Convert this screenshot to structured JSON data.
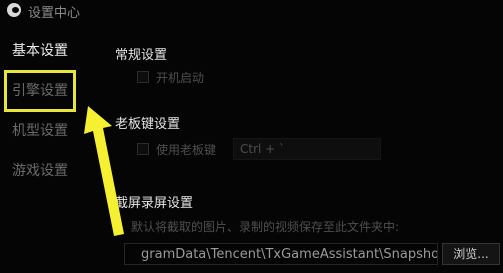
{
  "window": {
    "title": "设置中心"
  },
  "sidebar": {
    "items": [
      {
        "label": "基本设置"
      },
      {
        "label": "引擎设置"
      },
      {
        "label": "机型设置"
      },
      {
        "label": "游戏设置"
      }
    ]
  },
  "general": {
    "title": "常规设置",
    "autostart_label": "开机启动"
  },
  "boss_key": {
    "title": "老板键设置",
    "enable_label": "使用老板键",
    "hotkey_value": "Ctrl + `"
  },
  "screenshot": {
    "title": "截屏录屏设置",
    "hint": "默认将截取的图片、录制的视频保存至此文件夹中:",
    "path_value": "gramData\\Tencent\\TxGameAssistant\\Snapshot",
    "browse_label": "浏览..."
  },
  "colors": {
    "highlight": "#e8e63c",
    "background": "#050505"
  }
}
